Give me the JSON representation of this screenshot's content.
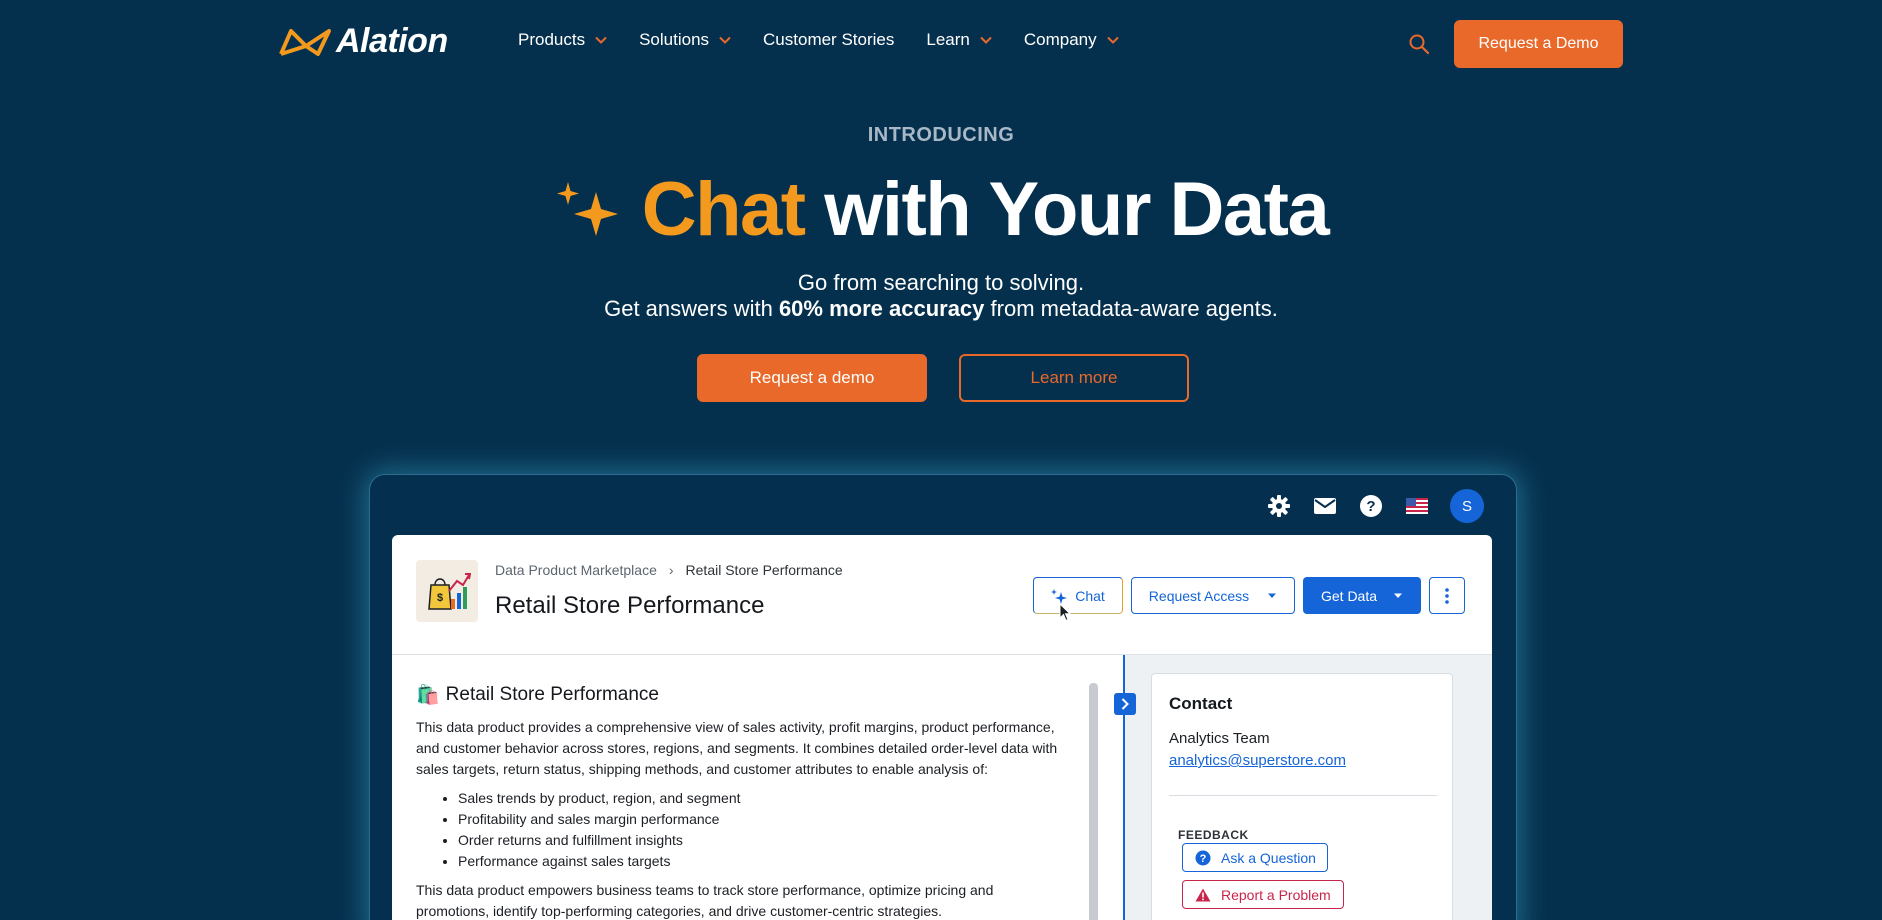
{
  "nav": {
    "logo_text": "Alation",
    "items": [
      {
        "label": "Products",
        "has_dropdown": true
      },
      {
        "label": "Solutions",
        "has_dropdown": true
      },
      {
        "label": "Customer Stories",
        "has_dropdown": false
      },
      {
        "label": "Learn",
        "has_dropdown": true
      },
      {
        "label": "Company",
        "has_dropdown": true
      }
    ],
    "search_icon": "search-icon",
    "cta_label": "Request a Demo"
  },
  "hero": {
    "eyebrow": "INTRODUCING",
    "title_highlight": "Chat",
    "title_rest": "with Your Data",
    "subtitle_line1": "Go from searching to solving.",
    "subtitle_line2_pre": "Get answers with ",
    "subtitle_line2_bold": "60% more accuracy",
    "subtitle_line2_post": " from metadata-aware agents.",
    "primary_cta": "Request a demo",
    "secondary_cta": "Learn more"
  },
  "app": {
    "top_icons": [
      "gear-icon",
      "mail-icon",
      "help-icon",
      "us-flag-icon"
    ],
    "avatar_initial": "S",
    "breadcrumb": {
      "parent": "Data Product Marketplace",
      "separator": "›",
      "current": "Retail Store Performance"
    },
    "title": "Retail Store Performance",
    "buttons": {
      "chat": "Chat",
      "request_access": "Request Access",
      "get_data": "Get Data"
    },
    "content": {
      "heading_emoji": "🛍️",
      "heading": "Retail Store Performance",
      "intro": "This data product provides a comprehensive view of sales activity, profit margins, product performance, and customer behavior across stores, regions, and segments. It combines detailed order-level data with sales targets, return status, shipping methods, and customer attributes to enable analysis of:",
      "bullets": [
        "Sales trends by product, region, and segment",
        "Profitability and sales margin performance",
        "Order returns and fulfillment insights",
        "Performance against sales targets"
      ],
      "outro": "This data product empowers business teams to track store performance, optimize pricing and promotions, identify top-performing categories, and drive customer-centric strategies."
    },
    "contact": {
      "heading": "Contact",
      "name": "Analytics Team",
      "email": "analytics@superstore.com",
      "feedback_label": "FEEDBACK",
      "ask_question": "Ask a Question",
      "report_problem": "Report a Problem"
    }
  },
  "colors": {
    "background": "#05304d",
    "accent_orange": "#e8692a",
    "highlight_orange": "#f39a1e",
    "primary_blue": "#1565d8",
    "danger_red": "#c9254b"
  }
}
